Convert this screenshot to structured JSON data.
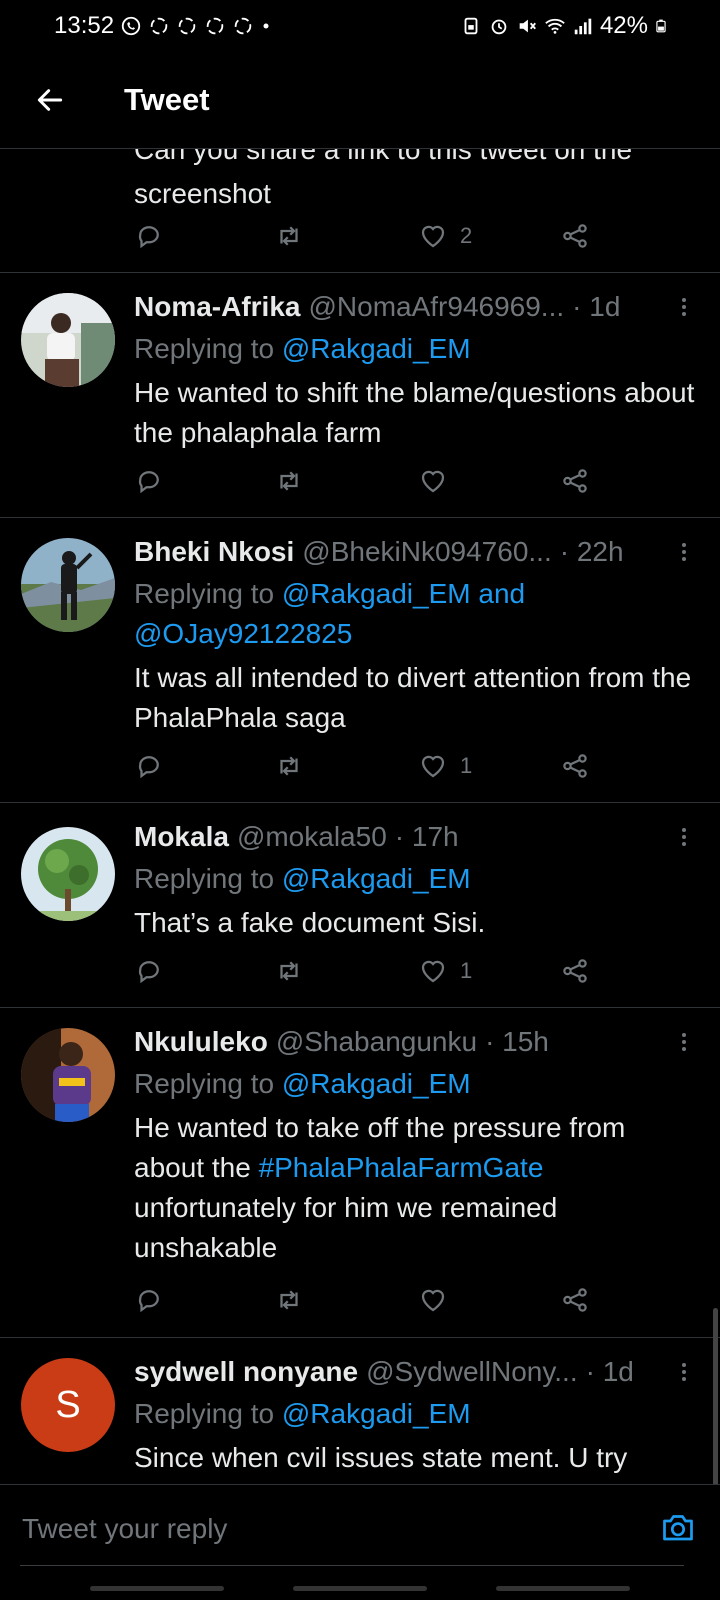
{
  "status_bar": {
    "time": "13:52",
    "battery": "42%",
    "left_icons": [
      "whatsapp-icon",
      "notification-icon",
      "notification-icon",
      "notification-icon",
      "notification-icon",
      "dot-icon"
    ],
    "right_icons": [
      "portrait-lock-icon",
      "alarm-icon",
      "mute-icon",
      "wifi-icon",
      "signal-icon",
      "battery-icon"
    ]
  },
  "header": {
    "title": "Tweet"
  },
  "partial_tweet": {
    "line1": "Can you share a link to this tweet on the",
    "line2": "screenshot",
    "likes": "2"
  },
  "tweets": [
    {
      "name": "Noma-Afrika",
      "handle": "@NomaAfr946969...",
      "time": "· 1d",
      "replying_prefix": "Replying to",
      "replying_to": "@Rakgadi_EM",
      "text": "He wanted to shift the blame/questions about the phalaphala farm",
      "likes": ""
    },
    {
      "name": "Bheki Nkosi",
      "handle": "@BhekiNk094760...",
      "time": "· 22h",
      "replying_prefix": "Replying to",
      "replying_to": "@Rakgadi_EM and",
      "replying_to_2": "@OJay92122825",
      "text": "It was all intended to divert attention from the PhalaPhala saga",
      "likes": "1"
    },
    {
      "name": "Mokala",
      "handle": "@mokala50",
      "time": "· 17h",
      "replying_prefix": "Replying to",
      "replying_to": "@Rakgadi_EM",
      "text": "That’s a fake document Sisi.",
      "likes": "1"
    },
    {
      "name": "Nkululeko",
      "handle": "@Shabangunku",
      "time": "· 15h",
      "replying_prefix": "Replying to",
      "replying_to": "@Rakgadi_EM",
      "text_before": "He wanted to take off the pressure from about the",
      "hashtag": "#PhalaPhalaFarmGate",
      "text_after": "unfortunately for him we remained unshakable",
      "likes": ""
    },
    {
      "name": "sydwell nonyane",
      "handle": "@SydwellNony...",
      "time": "· 1d",
      "avatar_letter": "S",
      "replying_prefix": "Replying to",
      "replying_to": "@Rakgadi_EM",
      "text": "Since when cvil issues state ment. U try"
    }
  ],
  "reply": {
    "placeholder": "Tweet your reply"
  },
  "colors": {
    "background": "#000000",
    "text": "#e7e9ea",
    "muted": "#71767b",
    "accent": "#1d9bf0",
    "divider": "#2f3336",
    "avatar_s": "#c93c16"
  }
}
